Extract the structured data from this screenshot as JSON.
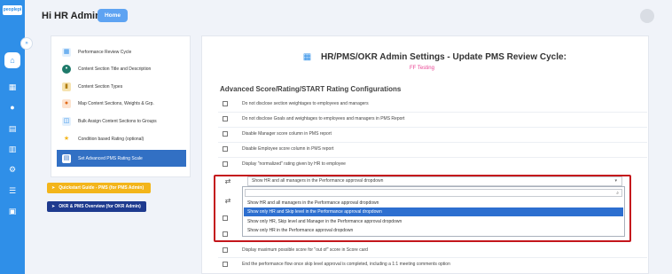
{
  "app": {
    "logo_text": "peoplepi",
    "greeting": "Hi HR Admin",
    "home_button": "Home",
    "rail_toggle": "»"
  },
  "rail_icons": [
    "home-icon",
    "calendar-icon",
    "people-icon",
    "document-icon",
    "chart-icon",
    "settings-icon",
    "list-icon",
    "grid-icon"
  ],
  "left_menu": {
    "items": [
      {
        "label": "Performance Review Cycle",
        "icon": "calendar-icon"
      },
      {
        "label": "Content Section Title and Description",
        "icon": "circle-icon"
      },
      {
        "label": "Content Section Types",
        "icon": "clipboard-icon"
      },
      {
        "label": "Map Content Sections, Weights & Grp.",
        "icon": "person-map-icon"
      },
      {
        "label": "Bulk Assign Content Sections to Groups",
        "icon": "bulk-icon"
      },
      {
        "label": "Condition based Rating (optional)",
        "icon": "star-icon"
      },
      {
        "label": "Set Advanced PMS Rating Scale",
        "icon": "scale-icon"
      }
    ],
    "quickstart_label": "Quickstart Guide - PMS (for PMS Admin)",
    "overview_label": "OKR & PMS Overview (for OKR Admin)"
  },
  "main": {
    "title": "HR/PMS/OKR Admin Settings - Update PMS Review Cycle:",
    "subtitle": "FF Testing",
    "section_heading": "Advanced Score/Rating/START Rating Configurations",
    "options": [
      "Do not disclose section weightages to employees and managers",
      "Do not disclose Goals and weightages to employees and managers in PMS Report",
      "Disable Manager score column in PMS report",
      "Disable Employee score column in PMS report",
      "Display \"normalized\" rating given by HR to employee",
      "Display maximum possible score for \"out of\" score in Score card",
      "End the performance flow once skip level approval is completed, including a 1:1 meeting comments option"
    ],
    "approval_select": {
      "value": "Show HR and all managers in the Performance approval dropdown",
      "options": [
        "Show HR and all managers in the Performance approval dropdown",
        "Show only HR and Skip level in the Performance approval dropdown",
        "Show only HR, Skip level and Manager in the Performance approval dropdown",
        "Show only HR in the Performance approval dropdown"
      ],
      "selected_index": 1
    }
  },
  "colors": {
    "rail": "#2f8fe8",
    "active_menu": "#3270c4",
    "quickstart": "#f3b51b",
    "overview": "#1e3a8f",
    "subtitle": "#e84393",
    "highlight_box": "#c4161c",
    "dropdown_selected": "#2d6fd0"
  }
}
